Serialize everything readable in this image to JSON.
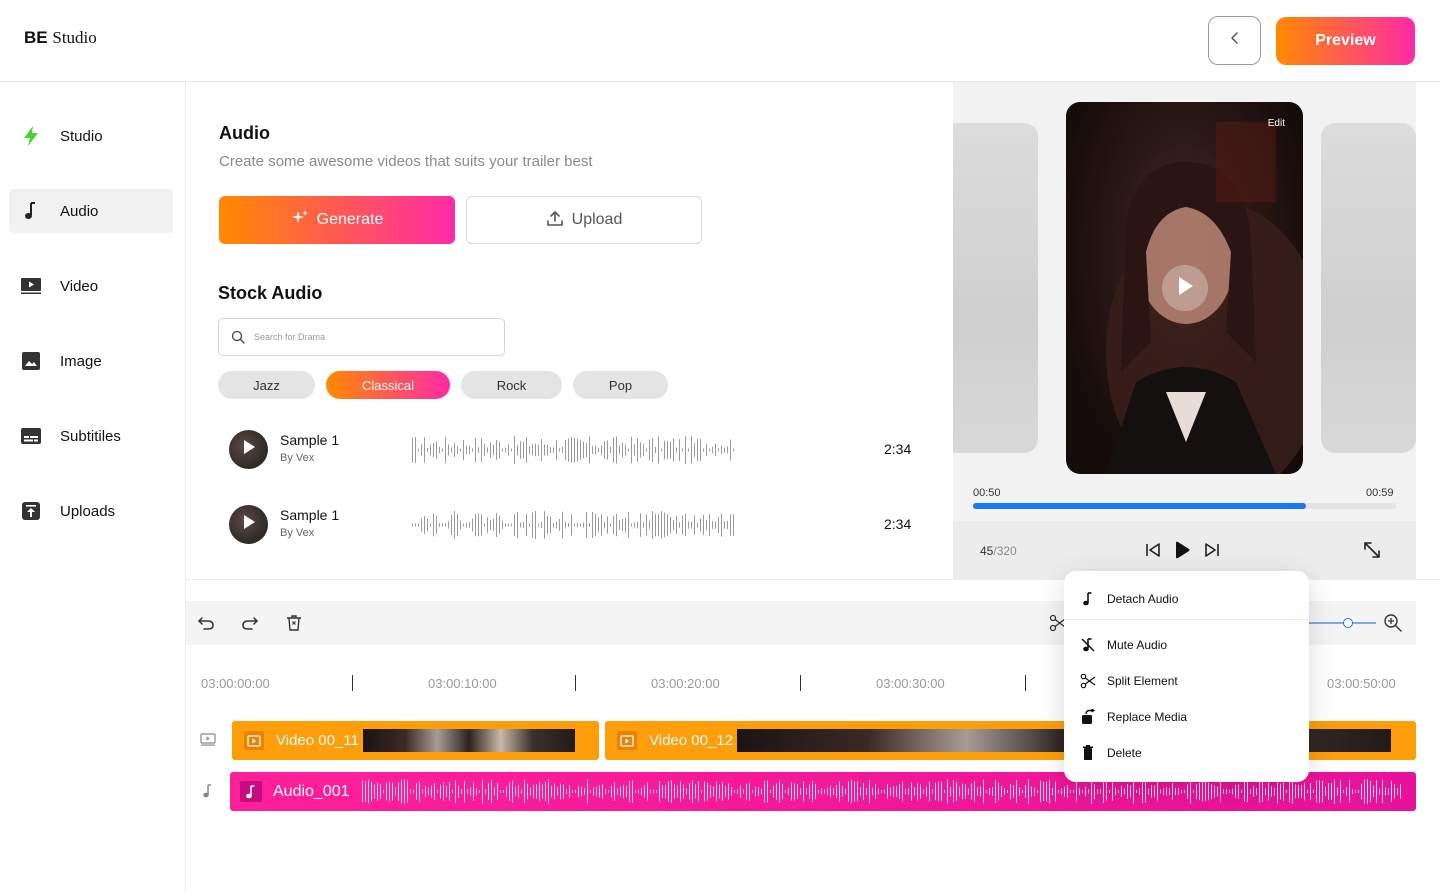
{
  "app": {
    "logo_bold": "BE",
    "logo_rest": "Studio",
    "preview_label": "Preview"
  },
  "sidebar": {
    "items": [
      {
        "label": "Studio",
        "icon": "bolt-icon"
      },
      {
        "label": "Audio",
        "icon": "music-note-icon"
      },
      {
        "label": "Video",
        "icon": "video-icon"
      },
      {
        "label": "Image",
        "icon": "image-icon"
      },
      {
        "label": "Subtitiles",
        "icon": "subtitles-icon"
      },
      {
        "label": "Uploads",
        "icon": "upload-icon"
      }
    ],
    "active": "Audio"
  },
  "audio_panel": {
    "title": "Audio",
    "subtitle": "Create some awesome videos that suits your trailer best",
    "generate_label": "Generate",
    "upload_label": "Upload",
    "stock_title": "Stock Audio",
    "search_placeholder": "Search for Drama",
    "genres": [
      "Jazz",
      "Classical",
      "Rock",
      "Pop"
    ],
    "active_genre": "Classical",
    "tracks": [
      {
        "name": "Sample 1",
        "artist": "By Vex",
        "duration": "2:34"
      },
      {
        "name": "Sample 1",
        "artist": "By Vex",
        "duration": "2:34"
      }
    ]
  },
  "preview": {
    "edit_label": "Edit",
    "time_current": "00:50",
    "time_total": "00:59",
    "progress_fraction": 0.787,
    "frame_current": "45",
    "frame_total": "/320"
  },
  "timeline": {
    "ruler": [
      "03:00:00:00",
      "03:00:10:00",
      "03:00:20:00",
      "03:00:30:00",
      "03:00:50:00"
    ],
    "video_clips": [
      {
        "label": "Video 00_11"
      },
      {
        "label": "Video 00_12"
      }
    ],
    "audio_clip": {
      "label": "Audio_001"
    },
    "zoom_fraction": 0.6
  },
  "context_menu": {
    "items": [
      {
        "label": "Detach Audio",
        "icon": "music-note-icon"
      },
      {
        "label": "Mute Audio",
        "icon": "mute-note-icon"
      },
      {
        "label": "Split Element",
        "icon": "scissors-icon"
      },
      {
        "label": "Replace Media",
        "icon": "replace-icon"
      },
      {
        "label": "Delete",
        "icon": "trash-icon"
      }
    ]
  },
  "colors": {
    "accent_start": "#ff8a00",
    "accent_end": "#ff2aa6",
    "video_clip": "#ff9d0a",
    "audio_clip": "#ff1f9a",
    "progress": "#1877f2",
    "studio_icon": "#4cd137"
  }
}
